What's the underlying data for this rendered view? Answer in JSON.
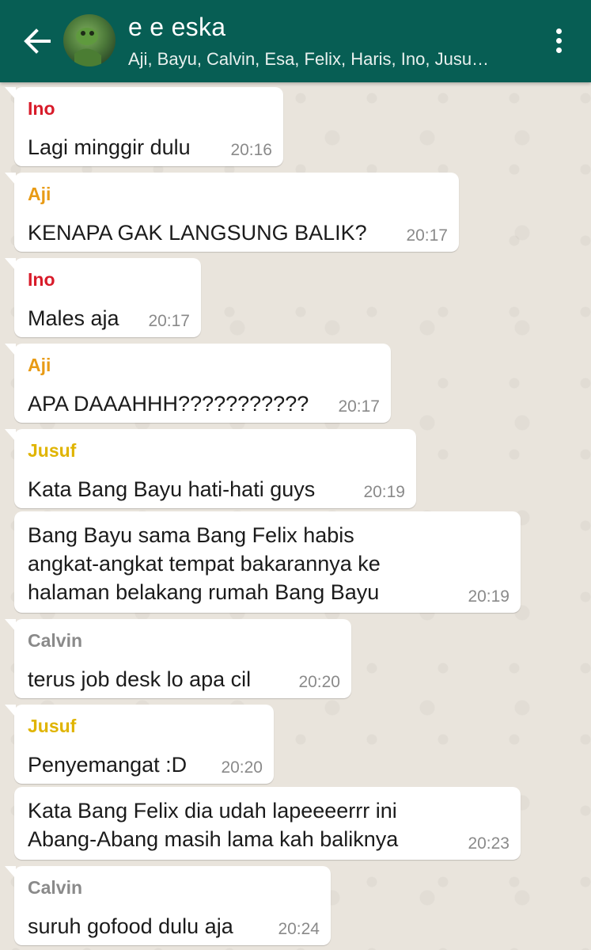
{
  "header": {
    "title": "e e eska",
    "subtitle": "Aji, Bayu, Calvin, Esa, Felix, Haris, Ino, Jusu…"
  },
  "colors": {
    "header_bg": "#075e54",
    "ino": "#d81b2a",
    "aji": "#e89b16",
    "jusuf": "#e0b400",
    "calvin": "#8a8a8a"
  },
  "messages": [
    {
      "sender": "Ino",
      "lines": [
        "Lagi minggir dulu"
      ],
      "time": "20:16"
    },
    {
      "sender": "Aji",
      "lines": [
        "KENAPA GAK LANGSUNG BALIK?"
      ],
      "time": "20:17"
    },
    {
      "sender": "Ino",
      "lines": [
        "Males aja"
      ],
      "time": "20:17"
    },
    {
      "sender": "Aji",
      "lines": [
        "APA DAAAHHH???????????"
      ],
      "time": "20:17"
    },
    {
      "sender": "Jusuf",
      "lines": [
        "Kata Bang Bayu hati-hati guys"
      ],
      "time": "20:19"
    },
    {
      "sender": "",
      "lines": [
        "Bang Bayu sama Bang Felix habis",
        "angkat-angkat tempat bakarannya ke",
        "halaman belakang rumah Bang Bayu"
      ],
      "time": "20:19"
    },
    {
      "sender": "Calvin",
      "lines": [
        "terus job desk lo apa cil"
      ],
      "time": "20:20"
    },
    {
      "sender": "Jusuf",
      "lines": [
        "Penyemangat :D"
      ],
      "time": "20:20"
    },
    {
      "sender": "",
      "lines": [
        "Kata Bang Felix dia udah lapeeeerrr ini",
        "Abang-Abang masih lama kah baliknya"
      ],
      "time": "20:23"
    },
    {
      "sender": "Calvin",
      "lines": [
        "suruh gofood dulu aja"
      ],
      "time": "20:24"
    }
  ]
}
